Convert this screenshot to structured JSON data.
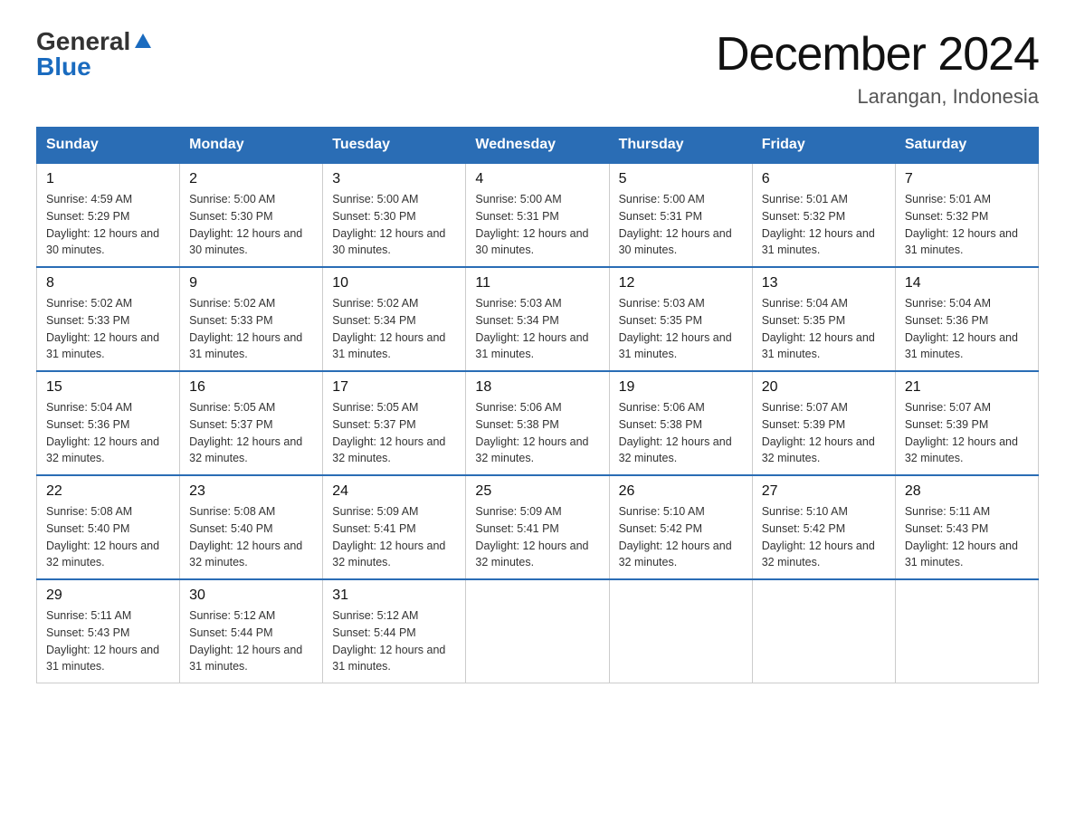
{
  "header": {
    "title": "December 2024",
    "location": "Larangan, Indonesia",
    "logo_general": "General",
    "logo_blue": "Blue"
  },
  "days_of_week": [
    "Sunday",
    "Monday",
    "Tuesday",
    "Wednesday",
    "Thursday",
    "Friday",
    "Saturday"
  ],
  "weeks": [
    [
      {
        "day": "1",
        "sunrise": "4:59 AM",
        "sunset": "5:29 PM",
        "daylight": "12 hours and 30 minutes."
      },
      {
        "day": "2",
        "sunrise": "5:00 AM",
        "sunset": "5:30 PM",
        "daylight": "12 hours and 30 minutes."
      },
      {
        "day": "3",
        "sunrise": "5:00 AM",
        "sunset": "5:30 PM",
        "daylight": "12 hours and 30 minutes."
      },
      {
        "day": "4",
        "sunrise": "5:00 AM",
        "sunset": "5:31 PM",
        "daylight": "12 hours and 30 minutes."
      },
      {
        "day": "5",
        "sunrise": "5:00 AM",
        "sunset": "5:31 PM",
        "daylight": "12 hours and 30 minutes."
      },
      {
        "day": "6",
        "sunrise": "5:01 AM",
        "sunset": "5:32 PM",
        "daylight": "12 hours and 31 minutes."
      },
      {
        "day": "7",
        "sunrise": "5:01 AM",
        "sunset": "5:32 PM",
        "daylight": "12 hours and 31 minutes."
      }
    ],
    [
      {
        "day": "8",
        "sunrise": "5:02 AM",
        "sunset": "5:33 PM",
        "daylight": "12 hours and 31 minutes."
      },
      {
        "day": "9",
        "sunrise": "5:02 AM",
        "sunset": "5:33 PM",
        "daylight": "12 hours and 31 minutes."
      },
      {
        "day": "10",
        "sunrise": "5:02 AM",
        "sunset": "5:34 PM",
        "daylight": "12 hours and 31 minutes."
      },
      {
        "day": "11",
        "sunrise": "5:03 AM",
        "sunset": "5:34 PM",
        "daylight": "12 hours and 31 minutes."
      },
      {
        "day": "12",
        "sunrise": "5:03 AM",
        "sunset": "5:35 PM",
        "daylight": "12 hours and 31 minutes."
      },
      {
        "day": "13",
        "sunrise": "5:04 AM",
        "sunset": "5:35 PM",
        "daylight": "12 hours and 31 minutes."
      },
      {
        "day": "14",
        "sunrise": "5:04 AM",
        "sunset": "5:36 PM",
        "daylight": "12 hours and 31 minutes."
      }
    ],
    [
      {
        "day": "15",
        "sunrise": "5:04 AM",
        "sunset": "5:36 PM",
        "daylight": "12 hours and 32 minutes."
      },
      {
        "day": "16",
        "sunrise": "5:05 AM",
        "sunset": "5:37 PM",
        "daylight": "12 hours and 32 minutes."
      },
      {
        "day": "17",
        "sunrise": "5:05 AM",
        "sunset": "5:37 PM",
        "daylight": "12 hours and 32 minutes."
      },
      {
        "day": "18",
        "sunrise": "5:06 AM",
        "sunset": "5:38 PM",
        "daylight": "12 hours and 32 minutes."
      },
      {
        "day": "19",
        "sunrise": "5:06 AM",
        "sunset": "5:38 PM",
        "daylight": "12 hours and 32 minutes."
      },
      {
        "day": "20",
        "sunrise": "5:07 AM",
        "sunset": "5:39 PM",
        "daylight": "12 hours and 32 minutes."
      },
      {
        "day": "21",
        "sunrise": "5:07 AM",
        "sunset": "5:39 PM",
        "daylight": "12 hours and 32 minutes."
      }
    ],
    [
      {
        "day": "22",
        "sunrise": "5:08 AM",
        "sunset": "5:40 PM",
        "daylight": "12 hours and 32 minutes."
      },
      {
        "day": "23",
        "sunrise": "5:08 AM",
        "sunset": "5:40 PM",
        "daylight": "12 hours and 32 minutes."
      },
      {
        "day": "24",
        "sunrise": "5:09 AM",
        "sunset": "5:41 PM",
        "daylight": "12 hours and 32 minutes."
      },
      {
        "day": "25",
        "sunrise": "5:09 AM",
        "sunset": "5:41 PM",
        "daylight": "12 hours and 32 minutes."
      },
      {
        "day": "26",
        "sunrise": "5:10 AM",
        "sunset": "5:42 PM",
        "daylight": "12 hours and 32 minutes."
      },
      {
        "day": "27",
        "sunrise": "5:10 AM",
        "sunset": "5:42 PM",
        "daylight": "12 hours and 32 minutes."
      },
      {
        "day": "28",
        "sunrise": "5:11 AM",
        "sunset": "5:43 PM",
        "daylight": "12 hours and 31 minutes."
      }
    ],
    [
      {
        "day": "29",
        "sunrise": "5:11 AM",
        "sunset": "5:43 PM",
        "daylight": "12 hours and 31 minutes."
      },
      {
        "day": "30",
        "sunrise": "5:12 AM",
        "sunset": "5:44 PM",
        "daylight": "12 hours and 31 minutes."
      },
      {
        "day": "31",
        "sunrise": "5:12 AM",
        "sunset": "5:44 PM",
        "daylight": "12 hours and 31 minutes."
      },
      {
        "day": "",
        "sunrise": "",
        "sunset": "",
        "daylight": ""
      },
      {
        "day": "",
        "sunrise": "",
        "sunset": "",
        "daylight": ""
      },
      {
        "day": "",
        "sunrise": "",
        "sunset": "",
        "daylight": ""
      },
      {
        "day": "",
        "sunrise": "",
        "sunset": "",
        "daylight": ""
      }
    ]
  ]
}
